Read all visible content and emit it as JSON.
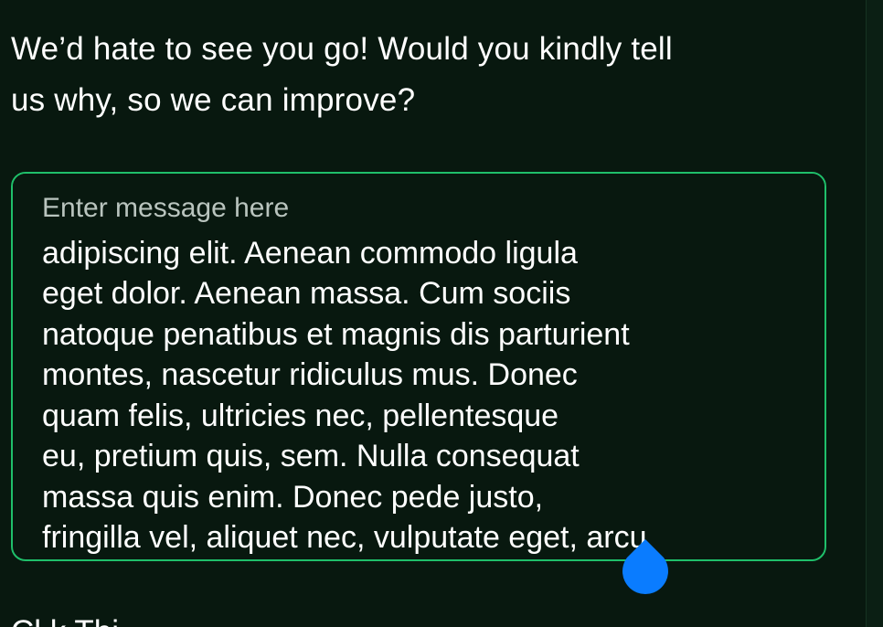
{
  "prompt": {
    "line1": "We’d hate to see you go! Would you kindly tell",
    "line2": "us why, so we can improve?"
  },
  "message_field": {
    "label": "Enter message here",
    "value": "Lorem ipsum dolor sit amet, consectetuer\nadipiscing elit. Aenean commodo ligula\neget dolor. Aenean massa. Cum sociis\nnatoque penatibus et magnis dis parturient\nmontes, nascetur ridiculus mus. Donec\nquam felis, ultricies nec, pellentesque\neu, pretium quis, sem. Nulla consequat\nmassa quis enim. Donec pede justo,\nfringilla vel, aliquet nec, vulputate eget, arcu",
    "border_color": "#1fbf6a"
  },
  "selection_handle": {
    "icon": "text-cursor-handle-icon",
    "color": "#0a7cff"
  },
  "next_section": {
    "text": "Cl                                              k      Thi"
  }
}
